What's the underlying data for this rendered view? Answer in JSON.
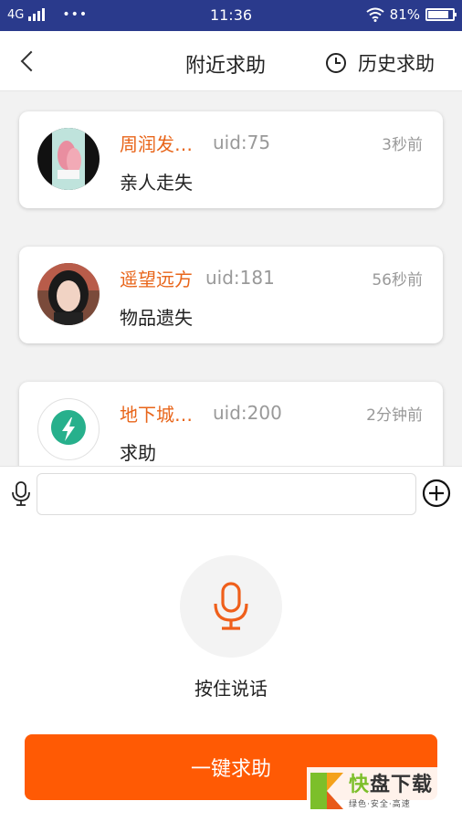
{
  "status_bar": {
    "network": "4G",
    "dots": "•••",
    "time": "11:36",
    "battery": "81%"
  },
  "nav": {
    "back_icon": "chevron-left-icon",
    "title": "附近求助",
    "history_icon": "clock-icon",
    "history_label": "历史求助"
  },
  "requests": [
    {
      "name": "周润发…",
      "uid": "uid:75",
      "time": "3秒前",
      "type": "亲人走失",
      "avatar": "photo-avatar"
    },
    {
      "name": "遥望远方",
      "uid": "uid:181",
      "time": "56秒前",
      "type": "物品遗失",
      "avatar": "photo-avatar"
    },
    {
      "name": "地下城…",
      "uid": "uid:200",
      "time": "2分钟前",
      "type": "求助",
      "avatar": "lightning-icon"
    }
  ],
  "input_bar": {
    "mic_icon": "microphone-icon",
    "value": "",
    "placeholder": "",
    "add_icon": "plus-circle-icon"
  },
  "voice": {
    "mic_icon": "microphone-icon",
    "hold_label": "按住说话",
    "button_label": "一键求助"
  },
  "watermark": {
    "title_accent": "快",
    "title": "盘下载",
    "subtitle": "绿色·安全·高速"
  },
  "colors": {
    "status_bar": "#2a3a8c",
    "accent": "#ff5a04",
    "name": "#e8651a",
    "muted": "#999999",
    "list_bg": "#f2f2f2"
  }
}
